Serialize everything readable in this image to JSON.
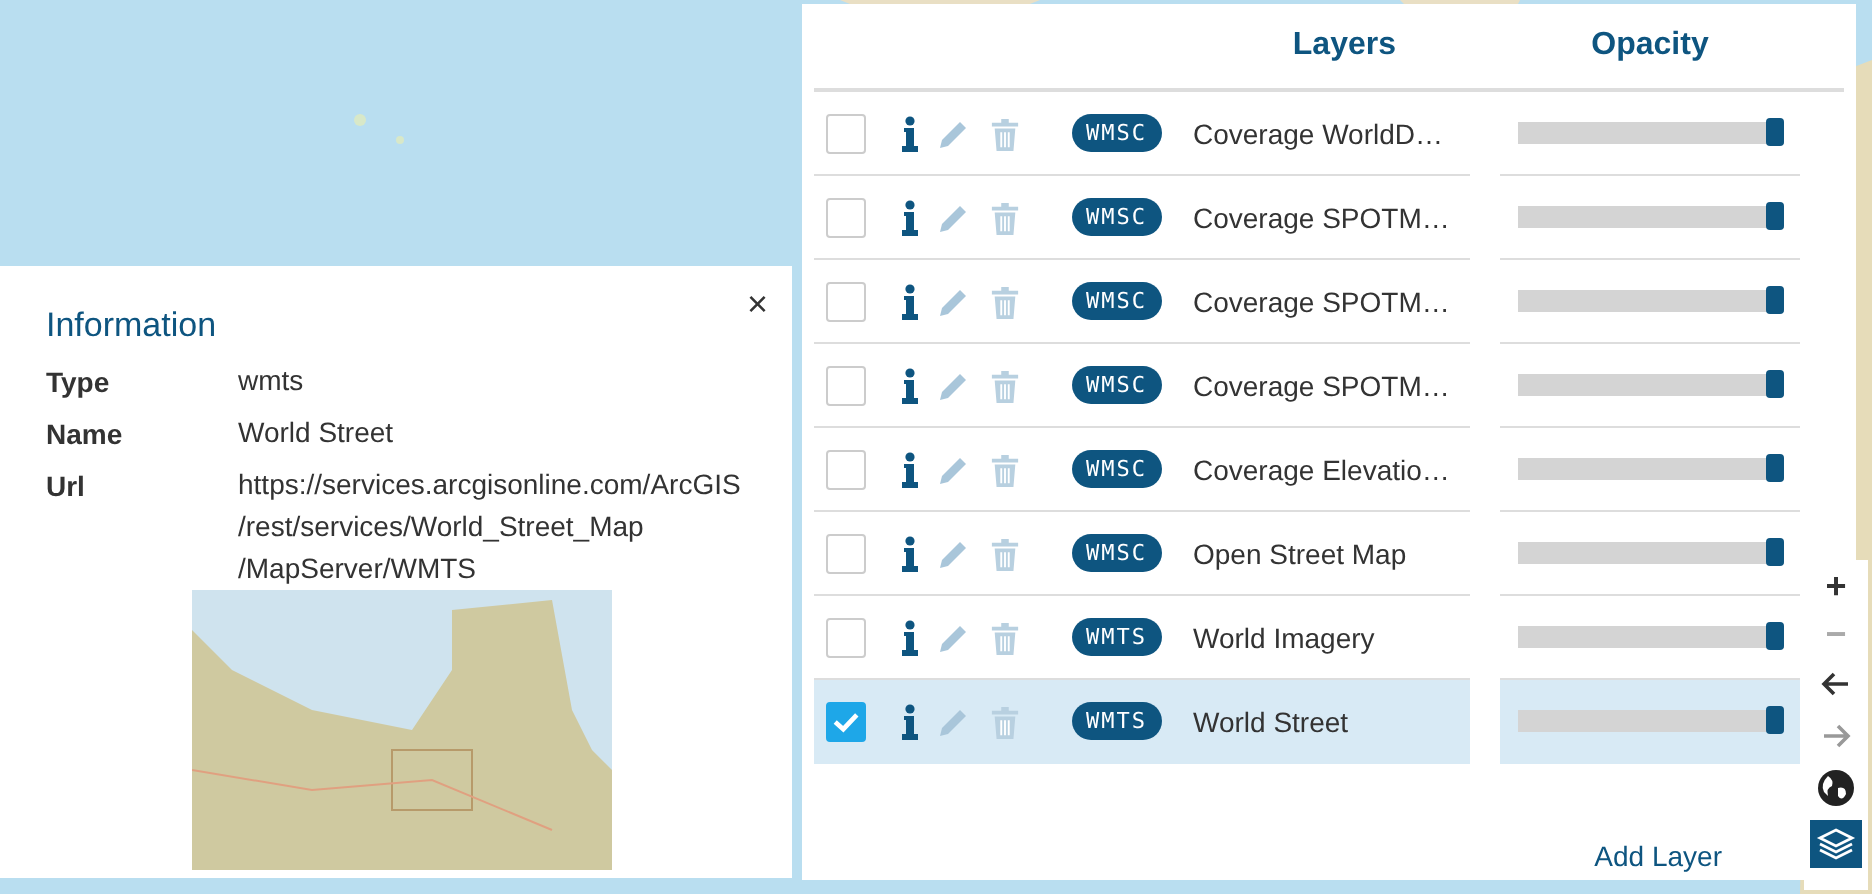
{
  "info_panel": {
    "title": "Information",
    "close": "×",
    "fields": [
      {
        "label": "Type",
        "value": "wmts"
      },
      {
        "label": "Name",
        "value": "World Street"
      },
      {
        "label": "Url",
        "value": "https://services.arcgisonline.com/ArcGIS /rest/services/World_Street_Map /MapServer/WMTS"
      }
    ]
  },
  "layers_panel": {
    "columns": [
      "Layers",
      "Opacity"
    ],
    "rows": [
      {
        "checked": false,
        "type": "WMSC",
        "name": "Coverage WorldD…",
        "level": 1
      },
      {
        "checked": false,
        "type": "WMSC",
        "name": "Coverage SPOTM…",
        "level": 1
      },
      {
        "checked": false,
        "type": "WMSC",
        "name": "Coverage SPOTM…",
        "level": 1
      },
      {
        "checked": false,
        "type": "WMSC",
        "name": "Coverage SPOTM…",
        "level": 1
      },
      {
        "checked": false,
        "type": "WMSC",
        "name": "Coverage Elevatio…",
        "level": 1
      },
      {
        "checked": false,
        "type": "WMSC",
        "name": "Open Street Map",
        "level": 1
      },
      {
        "checked": false,
        "type": "WMTS",
        "name": "World Imagery",
        "level": 1
      },
      {
        "checked": true,
        "type": "WMTS",
        "name": "World Street",
        "level": 1
      }
    ],
    "add_button": "Add Layer"
  },
  "map_controls": [
    {
      "kind": "zoom-in",
      "label": "+"
    },
    {
      "kind": "zoom-out",
      "label": "−"
    },
    {
      "kind": "back"
    },
    {
      "kind": "forward"
    },
    {
      "kind": "globe"
    },
    {
      "kind": "layers",
      "selected": true
    }
  ]
}
